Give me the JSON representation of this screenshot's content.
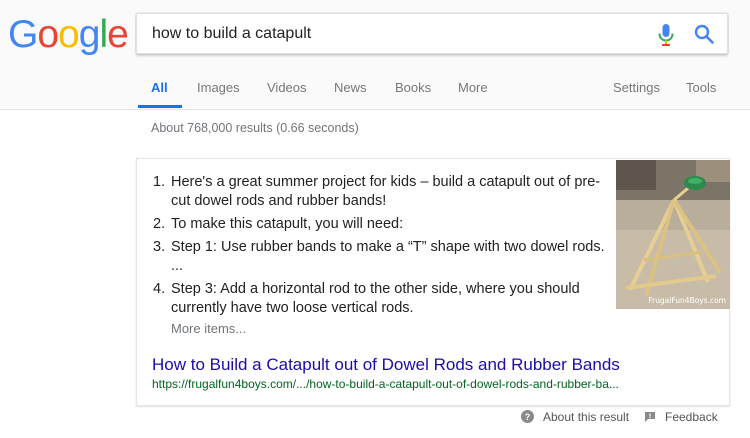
{
  "logo": {
    "letters": [
      "G",
      "o",
      "o",
      "g",
      "l",
      "e"
    ],
    "colors": [
      "#4285f4",
      "#ea4335",
      "#fbbc05",
      "#4285f4",
      "#34a853",
      "#ea4335"
    ]
  },
  "search": {
    "query": "how to build a catapult",
    "mic_icon": "mic-icon",
    "search_icon": "search-icon"
  },
  "tabs": [
    {
      "label": "All",
      "active": true
    },
    {
      "label": "Images"
    },
    {
      "label": "Videos"
    },
    {
      "label": "News"
    },
    {
      "label": "Books"
    },
    {
      "label": "More"
    },
    {
      "label": "Settings"
    },
    {
      "label": "Tools"
    }
  ],
  "result_stats": "About 768,000 results (0.66 seconds)",
  "featured_snippet": {
    "steps": [
      {
        "number": "1.",
        "text": "Here's a great summer project for kids – build a catapult out of pre-cut dowel rods and rubber bands!"
      },
      {
        "number": "2.",
        "text": "To make this catapult, you will need:"
      },
      {
        "number": "3.",
        "text": "Step 1: Use rubber bands to make a “T” shape with two dowel rods. ..."
      },
      {
        "number": "4.",
        "text": "Step 3: Add a horizontal rod to the other side, where you should currently have two loose vertical rods."
      }
    ],
    "more_items": "More items...",
    "image_caption": "FrugalFun4Boys.com",
    "title": "How to Build a Catapult out of Dowel Rods and Rubber Bands",
    "url": "https://frugalfun4boys.com/.../how-to-build-a-catapult-out-of-dowel-rods-and-rubber-ba..."
  },
  "footer": {
    "about": "About this result",
    "feedback": "Feedback"
  },
  "colors": {
    "link": "#1a0dab",
    "url": "#006621",
    "accent": "#1a73e8"
  }
}
